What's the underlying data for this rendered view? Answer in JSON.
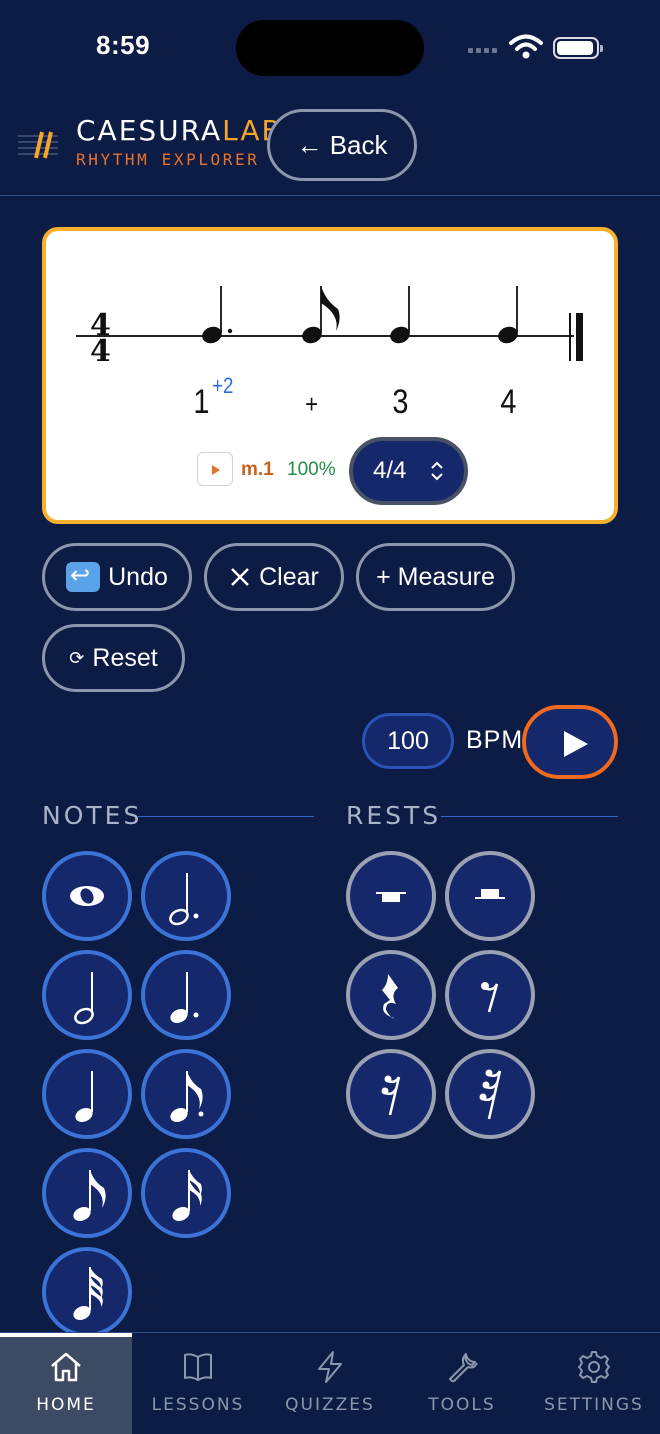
{
  "status_bar": {
    "time": "8:59"
  },
  "header": {
    "brand_main": "CAESURA",
    "brand_accent": "LAB",
    "brand_sub": "RHYTHM EXPLORER",
    "back_label": "← Back"
  },
  "staff": {
    "time_signature": {
      "top": "4",
      "bottom": "4"
    },
    "counts": [
      "1",
      "+",
      "3",
      "4"
    ],
    "count_sub": "+2",
    "measure_label": "m.1",
    "zoom_label": "100%",
    "time_sig_select": "4/4",
    "notes": [
      "dotted-quarter",
      "eighth",
      "quarter",
      "quarter"
    ]
  },
  "actions": {
    "undo": "Undo",
    "clear": "Clear",
    "add_measure": "+ Measure",
    "reset": "Reset"
  },
  "tempo": {
    "bpm_value": "100",
    "bpm_label": "BPM"
  },
  "palette": {
    "notes_title": "NOTES",
    "rests_title": "RESTS",
    "notes": [
      "whole",
      "dotted-half",
      "half",
      "dotted-quarter",
      "quarter",
      "dotted-eighth",
      "eighth",
      "sixteenth",
      "thirty-second"
    ],
    "rests": [
      "whole-rest",
      "half-rest",
      "quarter-rest",
      "eighth-rest",
      "sixteenth-rest",
      "thirty-second-rest"
    ]
  },
  "tabs": [
    {
      "label": "HOME",
      "icon": "home-icon",
      "active": true
    },
    {
      "label": "LESSONS",
      "icon": "book-icon",
      "active": false
    },
    {
      "label": "QUIZZES",
      "icon": "bolt-icon",
      "active": false
    },
    {
      "label": "TOOLS",
      "icon": "wrench-icon",
      "active": false
    },
    {
      "label": "SETTINGS",
      "icon": "gear-icon",
      "active": false
    }
  ],
  "colors": {
    "background": "#0d1c45",
    "accent_orange": "#ef6a1f",
    "accent_gold": "#f6b02b",
    "note_ring": "#3b73d6",
    "rest_ring": "#9aa1b2"
  }
}
